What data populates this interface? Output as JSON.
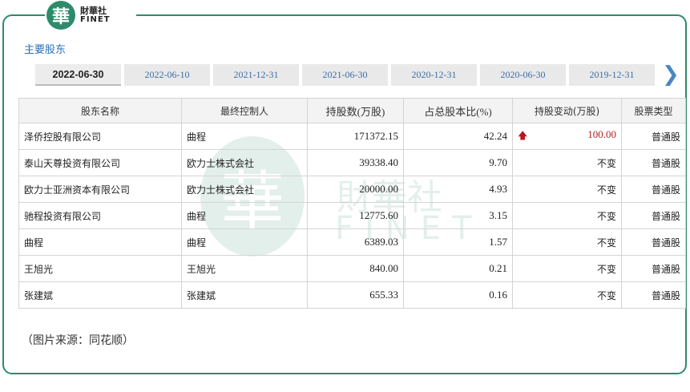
{
  "brand": {
    "logo_char": "華",
    "name_cn": "財華社",
    "name_en": "FINET",
    "color": "#2e8b6a"
  },
  "section_title": "主要股东",
  "tabs": [
    {
      "label": "2022-06-30",
      "active": true
    },
    {
      "label": "2022-06-10",
      "active": false
    },
    {
      "label": "2021-12-31",
      "active": false
    },
    {
      "label": "2021-06-30",
      "active": false
    },
    {
      "label": "2020-12-31",
      "active": false
    },
    {
      "label": "2020-06-30",
      "active": false
    },
    {
      "label": "2019-12-31",
      "active": false
    }
  ],
  "tab_next_icon": "chevron-right-icon",
  "table": {
    "headers": [
      "股东名称",
      "最终控制人",
      "持股数(万股)",
      "占总股本比(%)",
      "持股变动(万股)",
      "股票类型"
    ],
    "rows": [
      {
        "name": "泽侨控股有限公司",
        "controller": "曲程",
        "shares": "171372.15",
        "ratio": "42.24",
        "change": "100.00",
        "change_up": true,
        "type": "普通股"
      },
      {
        "name": "泰山天尊投资有限公司",
        "controller": "欧力士株式会社",
        "shares": "39338.40",
        "ratio": "9.70",
        "change": "不变",
        "change_up": false,
        "type": "普通股"
      },
      {
        "name": "欧力士亚洲资本有限公司",
        "controller": "欧力士株式会社",
        "shares": "20000.00",
        "ratio": "4.93",
        "change": "不变",
        "change_up": false,
        "type": "普通股"
      },
      {
        "name": "驰程投资有限公司",
        "controller": "曲程",
        "shares": "12775.60",
        "ratio": "3.15",
        "change": "不变",
        "change_up": false,
        "type": "普通股"
      },
      {
        "name": "曲程",
        "controller": "曲程",
        "shares": "6389.03",
        "ratio": "1.57",
        "change": "不变",
        "change_up": false,
        "type": "普通股"
      },
      {
        "name": "王旭光",
        "controller": "王旭光",
        "shares": "840.00",
        "ratio": "0.21",
        "change": "不变",
        "change_up": false,
        "type": "普通股"
      },
      {
        "name": "张建斌",
        "controller": "张建斌",
        "shares": "655.33",
        "ratio": "0.16",
        "change": "不变",
        "change_up": false,
        "type": "普通股"
      }
    ]
  },
  "source_note": "（图片来源：同花顺）"
}
